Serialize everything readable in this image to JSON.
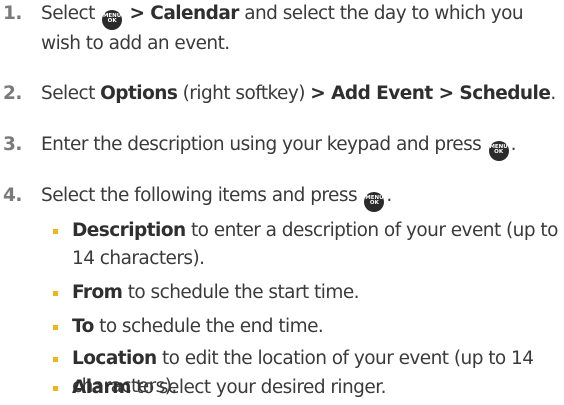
{
  "steps": [
    {
      "num": "1.",
      "pre": "Select ",
      "key": {
        "top": "MENU",
        "bottom": "OK"
      },
      "bold": "> Calendar",
      "post": " and select the day to which you wish to add an event."
    },
    {
      "num": "2.",
      "pre": "Select ",
      "bold1": "Options",
      "mid": " (right softkey) ",
      "bold2": "> Add Event > Schedule",
      "post": "."
    },
    {
      "num": "3.",
      "pre": "Enter the description using your keypad and press ",
      "post": "."
    },
    {
      "num": "4.",
      "pre": "Select the following items and press ",
      "post": "."
    }
  ],
  "bullets": [
    {
      "bold": "Description",
      "text": " to enter a description of your event (up to 14 characters)."
    },
    {
      "bold": "From",
      "text": " to schedule the start time."
    },
    {
      "bold": "To",
      "text": " to schedule the end time."
    },
    {
      "bold": "Location",
      "text": " to edit the location of your event (up to 14 characters)."
    },
    {
      "bold": "Alarm",
      "text": " to select your desired ringer."
    }
  ],
  "colors": {
    "bullet": "#f2b31b",
    "number": "#7a7a7a",
    "text": "#3a3a3a"
  }
}
